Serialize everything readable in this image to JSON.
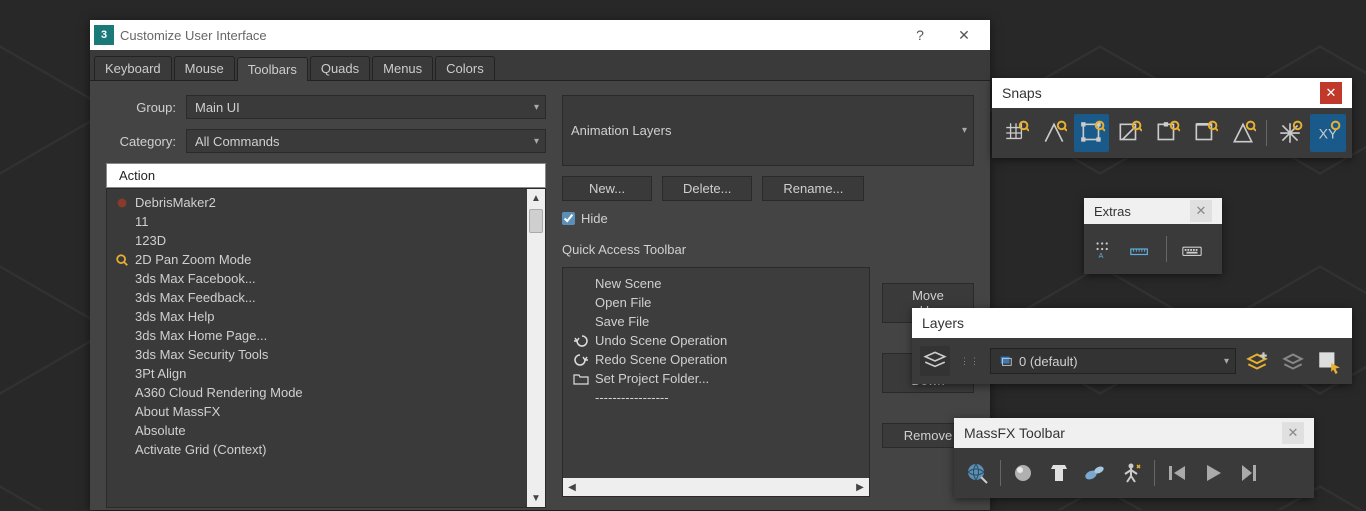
{
  "dialog": {
    "title": "Customize User Interface",
    "tabs": [
      "Keyboard",
      "Mouse",
      "Toolbars",
      "Quads",
      "Menus",
      "Colors"
    ],
    "active_tab": 2,
    "group_label": "Group:",
    "group_value": "Main UI",
    "category_label": "Category:",
    "category_value": "All Commands",
    "action_header": "Action",
    "actions": [
      "DebrisMaker2",
      "11",
      "123D",
      "2D Pan Zoom Mode",
      "3ds Max Facebook...",
      "3ds Max Feedback...",
      "3ds Max Help",
      "3ds Max Home Page...",
      "3ds Max Security Tools",
      "3Pt Align",
      "A360 Cloud Rendering Mode",
      "About MassFX",
      "Absolute",
      "Activate Grid (Context)"
    ],
    "toolbar_dropdown": "Animation Layers",
    "btn_new": "New...",
    "btn_delete": "Delete...",
    "btn_rename": "Rename...",
    "hide_label": "Hide",
    "qat_label": "Quick Access Toolbar",
    "qat_items": [
      "New Scene",
      "Open File",
      "Save File",
      "Undo Scene Operation",
      "Redo Scene Operation",
      "Set Project Folder...",
      "-----------------"
    ],
    "btn_moveup": "Move Up",
    "btn_movedown": "Move Down",
    "btn_remove": "Remove"
  },
  "snaps": {
    "title": "Snaps"
  },
  "extras": {
    "title": "Extras"
  },
  "layers": {
    "title": "Layers",
    "current": "0 (default)"
  },
  "massfx": {
    "title": "MassFX Toolbar"
  }
}
